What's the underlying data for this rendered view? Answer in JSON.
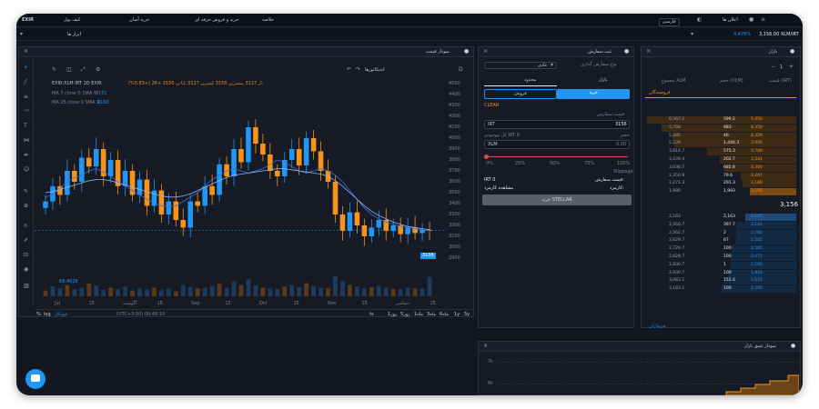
{
  "nav": {
    "logo": "EXIR",
    "items": [
      "کیف پول",
      "خرید آسان",
      "خرید و فروش حرفه ای",
      "خلاصه"
    ],
    "notifications": "اعلان ها",
    "lang": "فارسی"
  },
  "subbar": {
    "tools": "ابزار ها",
    "pair": "3,156.00 XLM/IRT",
    "change": "4.478%",
    "dropdown_icon": "chevron-down-icon"
  },
  "chart_panel": {
    "title": "نمودار قیمت",
    "symbol_line": "EXIR:XLM-IRT  1D  EXIR",
    "ohlc": "باز 3127  بیشترین 3156  کمترین 3127  پایانی 3156 +26 (+0.83%)",
    "ma7_label": "MA 7 close 0 SMA 9",
    "ma7_value": "3151",
    "ma25_label": "MA 25 close 0 SMA 9",
    "ma25_value": "3160",
    "indicators": "اندیکاتورها",
    "volume_label": "68.402K",
    "x_ticks": [
      "Jul",
      "15",
      "آگوست",
      "15",
      "Sep",
      "15",
      "Oct",
      "15",
      "Nov",
      "15",
      "دسامبر",
      "15"
    ],
    "y_ticks": [
      "4500",
      "4400",
      "4300",
      "4200",
      "4100",
      "4000",
      "3900",
      "3800",
      "3700",
      "3600",
      "3500",
      "3400",
      "3300",
      "3200",
      "3100",
      "3000",
      "2900"
    ],
    "price_tag": "3156",
    "ranges": [
      "5y",
      "1y",
      "6ماه",
      "3ماه",
      "1ماه",
      "5روز",
      "1روز"
    ],
    "timezone": "(UTC+3:30) 09:49:19",
    "scale_opts": [
      "%",
      "log",
      "خودکار"
    ]
  },
  "chart_data": {
    "type": "line",
    "title": "",
    "xlabel": "",
    "ylabel": "",
    "ylim": [
      2850,
      4550
    ],
    "series": [
      {
        "name": "MA 7",
        "values": [
          3460,
          3480,
          3540,
          3600,
          3640,
          3660,
          3700,
          3720,
          3690,
          3650,
          3600,
          3560,
          3520,
          3480,
          3440,
          3400,
          3380,
          3370,
          3380,
          3420,
          3460,
          3500,
          3560,
          3620,
          3660,
          3700,
          3720,
          3700,
          3680,
          3700,
          3720,
          3760,
          3800,
          3780,
          3740,
          3700,
          3680,
          3700,
          3720,
          3700,
          3660,
          3600,
          3520,
          3440,
          3360,
          3300,
          3260,
          3230,
          3210,
          3190,
          3180,
          3170,
          3160,
          3151
        ]
      },
      {
        "name": "MA 25",
        "values": [
          3500,
          3510,
          3530,
          3550,
          3570,
          3590,
          3610,
          3620,
          3620,
          3610,
          3590,
          3570,
          3550,
          3530,
          3510,
          3490,
          3470,
          3460,
          3460,
          3470,
          3490,
          3520,
          3550,
          3580,
          3610,
          3640,
          3660,
          3670,
          3680,
          3690,
          3700,
          3710,
          3720,
          3720,
          3710,
          3700,
          3690,
          3680,
          3670,
          3650,
          3610,
          3560,
          3500,
          3440,
          3380,
          3330,
          3290,
          3260,
          3230,
          3210,
          3190,
          3180,
          3170,
          3160
        ]
      }
    ],
    "candles_close": [
      3420,
      3560,
      3480,
      3700,
      3600,
      3820,
      3740,
      3900,
      3650,
      3800,
      3560,
      3700,
      3480,
      3620,
      3380,
      3520,
      3300,
      3420,
      3250,
      3180,
      3420,
      3380,
      3560,
      3480,
      3760,
      3650,
      3900,
      3780,
      4100,
      3950,
      3850,
      3700,
      3650,
      3800,
      3900,
      3750,
      4000,
      3880,
      3700,
      3600,
      3300,
      3150,
      3320,
      3200,
      3100,
      3180,
      3250,
      3150,
      3200,
      3120,
      3180,
      3130,
      3160,
      3156
    ],
    "volumes": [
      20,
      35,
      28,
      40,
      25,
      30,
      45,
      38,
      22,
      30,
      26,
      34,
      20,
      28,
      24,
      30,
      22,
      26,
      18,
      40,
      32,
      28,
      30,
      36,
      44,
      30,
      52,
      40,
      60,
      38,
      30,
      28,
      26,
      34,
      40,
      32,
      46,
      36,
      30,
      28,
      70,
      54,
      40,
      34,
      28,
      32,
      36,
      30,
      26,
      24,
      30,
      28,
      26,
      68
    ]
  },
  "order_form": {
    "title": "ثبت سفارش",
    "type_label": "نوع سفارش گذاری",
    "type_value": "عادی",
    "tabs": [
      "بازار",
      "محدود"
    ],
    "buy": "خرید",
    "sell": "فروش",
    "clear": "CLEAR",
    "price_label": "قیمت سفارش",
    "price_unit": "IRT",
    "price_value": "3156",
    "amount_label": "حجم",
    "balance_label": "کل موجودی IRT 0",
    "amount_unit": "XLM",
    "amount_value": "0.00",
    "slider_marks": [
      "0%",
      "25%",
      "50%",
      "75%",
      "100%"
    ],
    "slippage": "Slippage",
    "total_label": "قیمت سفارش:",
    "total_value": "IRT 0",
    "fee_label": "کارمزد:",
    "fee_value": "مشاهده کارمزد",
    "submit": "خرید STELLAR"
  },
  "orderbook": {
    "title": "بازار",
    "page_num": "1",
    "col_price": "قیمت (IRT)",
    "col_amount": "حجم (XLM)",
    "col_total": "مجموع XLM",
    "sellers": "فروشندگان",
    "buyers": "خریداران",
    "asks": [
      [
        "5,450",
        "599.2",
        "6,367.2"
      ],
      [
        "4,350",
        "483",
        "5,768"
      ],
      [
        "4,329",
        "46",
        "5,285"
      ],
      [
        "3,900",
        "1,446.3",
        "5,239"
      ],
      [
        "3,700",
        "575.3",
        "3,814.7"
      ],
      [
        "3,541",
        "202.7",
        "3,239.4"
      ],
      [
        "3,300",
        "685.8",
        "3,036.7"
      ],
      [
        "3,247",
        "79.6",
        "2,350.9"
      ],
      [
        "3,189",
        "291.3",
        "2,271.3"
      ],
      [
        "3,156",
        "1,993",
        "1,980"
      ]
    ],
    "last_price": "3,156",
    "bids": [
      [
        "3,145",
        "2,163",
        "2,163"
      ],
      [
        "3,141",
        "397.7",
        "2,560.7"
      ],
      [
        "2,780",
        "2",
        "2,562.7"
      ],
      [
        "2,502",
        "67",
        "2,629.7"
      ],
      [
        "2,501",
        "100",
        "2,729.7"
      ],
      [
        "2,471",
        "100",
        "2,829.7"
      ],
      [
        "2,200",
        "1",
        "2,830.7"
      ],
      [
        "1,843",
        "100",
        "2,930.7"
      ],
      [
        "1,616",
        "152.4",
        "3,083.1"
      ],
      [
        "1,200",
        "100",
        "3,183.1"
      ]
    ],
    "ask_ratios": [
      1.0,
      0.9,
      0.83,
      0.82,
      0.6,
      0.51,
      0.48,
      0.37,
      0.36,
      0.31
    ],
    "bid_ratios": [
      0.34,
      0.4,
      0.4,
      0.41,
      0.43,
      0.44,
      0.44,
      0.46,
      0.48,
      0.5
    ]
  },
  "depth": {
    "title": "نمودار عمق بازار",
    "y_ticks": [
      "7k",
      "6k"
    ]
  },
  "colors": {
    "accent": "#2196f3",
    "buy": "#2196f3",
    "sell": "#f7931a",
    "bg": "#131722",
    "panel": "#161a25"
  }
}
